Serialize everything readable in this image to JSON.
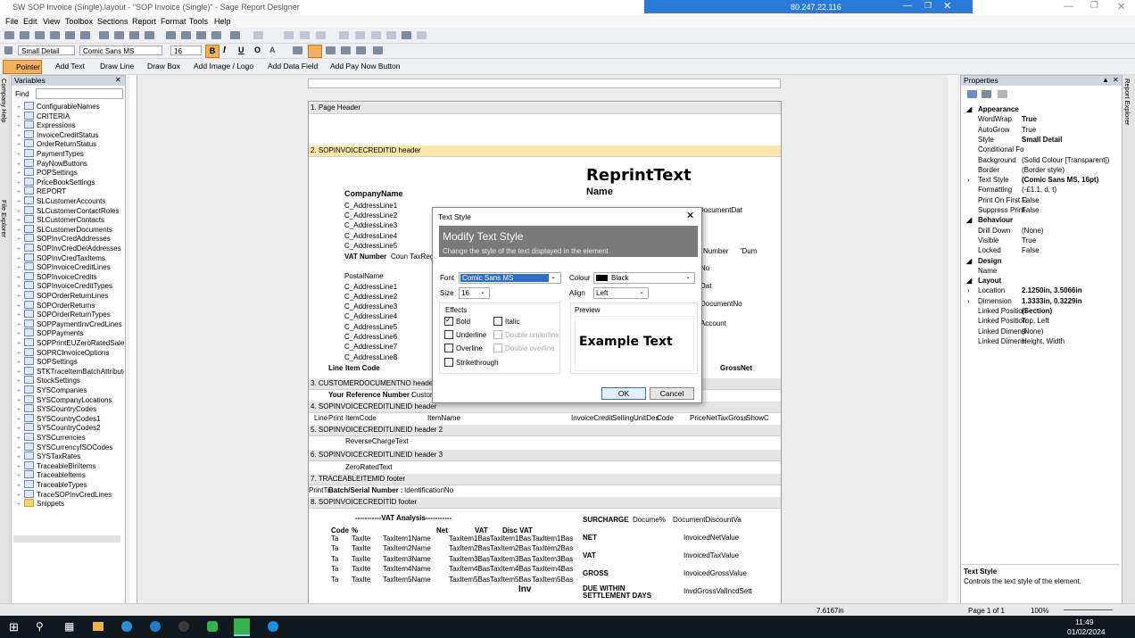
{
  "window": {
    "title": "SW SOP Invoice (Single).layout - \"SOP Invoice (Single)\" - Sage Report Designer",
    "remote_ip": "80.247.22.116"
  },
  "menu": [
    "File",
    "Edit",
    "View",
    "Toolbox",
    "Sections",
    "Report",
    "Format",
    "Tools",
    "Help"
  ],
  "format_bar": {
    "style": "Small Detail",
    "font": "Comic Sans MS",
    "size": "16"
  },
  "toolbox": {
    "pointer": "Pointer",
    "add_text": "Add Text",
    "draw_line": "Draw Line",
    "draw_box": "Draw Box",
    "add_image": "Add Image / Logo",
    "add_data_field": "Add Data Field",
    "add_pay_now": "Add Pay Now Button"
  },
  "variables_panel": {
    "title": "Variables",
    "find_label": "Find",
    "items": [
      "ConfigurableNames",
      "CRITERIA",
      "Expressions",
      "InvoiceCreditStatus",
      "OrderReturnStatus",
      "PaymentTypes",
      "PayNowButtons",
      "POPSettings",
      "PriceBookSettings",
      "REPORT",
      "SLCustomerAccounts",
      "SLCustomerContactRoles",
      "SLCustomerContacts",
      "SLCustomerDocuments",
      "SOPInvCredAddresses",
      "SOPInvCredDelAddresses",
      "SOPInvCredTaxItems",
      "SOPInvoiceCreditLines",
      "SOPInvoiceCredits",
      "SOPInvoiceCreditTypes",
      "SOPOrderReturnLines",
      "SOPOrderReturns",
      "SOPOrderReturnTypes",
      "SOPPaymentInvCredLines",
      "SOPPayments",
      "SOPPrintEUZeroRatedSalesO",
      "SOPRCInvoiceOptions",
      "SOPSettings",
      "STKTraceItemBatchAttribute",
      "StockSettings",
      "SYSCompanies",
      "SYSCompanyLocations",
      "SYSCountryCodes",
      "SYSCountryCodes1",
      "SYSCountryCodes2",
      "SYSCurrencies",
      "SYSCurrencyISOCodes",
      "SYSTaxRates",
      "TraceableBinItems",
      "TraceableItems",
      "TraceableTypes",
      "TraceSOPInvCredLines",
      "Snippets"
    ]
  },
  "side_tabs": {
    "left1": "Company Help",
    "left2": "File Explorer",
    "right": "Report Explorer"
  },
  "sections": [
    {
      "label": "1. Page Header"
    },
    {
      "label": "2. SOPINVOICECREDITID header"
    },
    {
      "label": "3. CUSTOMERDOCUMENTNO header"
    },
    {
      "label": "4. SOPINVOICECREDITLINEID header"
    },
    {
      "label": "5. SOPINVOICECREDITLINEID header 2"
    },
    {
      "label": "6. SOPINVOICECREDITLINEID header 3"
    },
    {
      "label": "7. TRACEABLEITEMID footer"
    },
    {
      "label": "8. SOPINVOICECREDITID footer"
    }
  ],
  "report_fields": {
    "reprint": "ReprintText",
    "name": "Name",
    "company": "CompanyName",
    "addr": [
      "C_AddressLine1",
      "C_AddressLine2",
      "C_AddressLine3",
      "C_AddressLine4",
      "C_AddressLine5"
    ],
    "vat_label": "VAT Number",
    "vat_value": "Coun TaxReg",
    "postal": "PostalName",
    "addr2": [
      "C_AddressLine1",
      "C_AddressLine2",
      "C_AddressLine3",
      "C_AddressLine4",
      "C_AddressLine5",
      "C_AddressLine6",
      "C_AddressLine7",
      "C_AddressLine8"
    ],
    "line": "Line",
    "item_code": "Item Code",
    "gross": "GrossNet",
    "document_dat": "DocumentDat",
    "number": "Number",
    "dum": "'Dum",
    "no": "No",
    "dat": "Dat",
    "document_no": "DocumentNo",
    "account": "Account",
    "your_ref": "Your Reference Number :",
    "custom": "Custom",
    "lineid_row": [
      "Line",
      "Print",
      "ItemCode",
      "ItemName",
      "InvoiceCredit",
      "SellingUnitDes",
      "Code",
      "PriceNetTaxGross",
      "ShowC"
    ],
    "reverse": "ReverseChargeText",
    "zero": "ZeroRatedText",
    "trace_row": [
      "PrintTr",
      "Batch/Serial Number :",
      "IdentificationNo"
    ],
    "vat_analysis": "-----------VAT Analysis-----------",
    "vat_cols": [
      "Code",
      "%",
      "Net",
      "VAT",
      "Disc VAT"
    ],
    "vat_rows": [
      [
        "Ta",
        "TaxIte",
        "TaxItem1Name",
        "TaxItem1Bas",
        "TaxItem1Bas",
        "TaxItem1Bas"
      ],
      [
        "Ta",
        "TaxIte",
        "TaxItem2Name",
        "TaxItem2Bas",
        "TaxItem2Bas",
        "TaxItem2Bas"
      ],
      [
        "Ta",
        "TaxIte",
        "TaxItem3Name",
        "TaxItem3Bas",
        "TaxItem3Bas",
        "TaxItem3Bas"
      ],
      [
        "Ta",
        "TaxIte",
        "TaxItem4Name",
        "TaxItem4Bas",
        "TaxItem4Bas",
        "TaxItem4Bas"
      ],
      [
        "Ta",
        "TaxIte",
        "TaxItem5Name",
        "TaxItem5Bas",
        "TaxItem5Bas",
        "TaxItem5Bas"
      ]
    ],
    "inv": "Inv",
    "totals": [
      [
        "SURCHARGE",
        "Docume%",
        "DocumentDiscountVa"
      ],
      [
        "NET",
        "",
        "InvoicedNetValue"
      ],
      [
        "VAT",
        "",
        "InvoicedTaxValue"
      ],
      [
        "GROSS",
        "",
        "InvoicedGrossValue"
      ],
      [
        "DUE WITHIN SETTLEMENT DAYS",
        "",
        "InvdGrossValIncdSett"
      ]
    ]
  },
  "properties": {
    "title": "Properties",
    "groups": [
      {
        "cat": "Appearance",
        "rows": [
          [
            "WordWrap",
            "True"
          ],
          [
            "AutoGrow",
            "True"
          ],
          [
            "Style",
            "Small Detail"
          ],
          [
            "Conditional Fo",
            ""
          ],
          [
            "Background",
            "(Solid Colour [Transparent])"
          ],
          [
            "Border",
            "(Border style)"
          ],
          [
            "Text Style",
            "(Comic Sans MS, 16pt)"
          ],
          [
            "Formatting",
            "(-£1.1, d, t)"
          ],
          [
            "Print On First C",
            "False"
          ],
          [
            "Suppress Print",
            "False"
          ]
        ]
      },
      {
        "cat": "Behaviour",
        "rows": [
          [
            "Drill Down",
            "(None)"
          ],
          [
            "Visible",
            "True"
          ],
          [
            "Locked",
            "False"
          ]
        ]
      },
      {
        "cat": "Design",
        "rows": [
          [
            "Name",
            ""
          ]
        ]
      },
      {
        "cat": "Layout",
        "rows": [
          [
            "Location",
            "2.1250in, 3.5066in"
          ],
          [
            "Dimension",
            "1.3333in, 0.3229in"
          ],
          [
            "Linked Position",
            "(Section)"
          ],
          [
            "Linked Position",
            "Top, Left"
          ],
          [
            "Linked Dimensi",
            "(None)"
          ],
          [
            "Linked Dimensi",
            "Height, Width"
          ]
        ]
      }
    ],
    "help_title": "Text Style",
    "help_text": "Controls the text style of the element."
  },
  "dialog": {
    "title": "Text Style",
    "heading": "Modify Text Style",
    "sub": "Change the style of the text displayed in the element",
    "font_label": "Font",
    "font_value": "Comic Sans MS",
    "size_label": "Size",
    "size_value": "16",
    "colour_label": "Colour",
    "colour_value": "Black",
    "align_label": "Align",
    "align_value": "Left",
    "effects_label": "Effects",
    "bold": "Bold",
    "italic": "Italic",
    "underline": "Underline",
    "double_underline": "Double underline",
    "overline": "Overline",
    "double_overline": "Double overline",
    "strikethrough": "Strikethrough",
    "preview_label": "Preview",
    "preview_text": "Example Text",
    "ok": "OK",
    "cancel": "Cancel"
  },
  "status": {
    "position": "7.6167in",
    "page": "Page 1 of 1",
    "zoom": "100%"
  },
  "clock": {
    "time": "11:49",
    "date": "01/02/2024"
  },
  "colors": {
    "accent": "#2f6fc9",
    "selected_section": "#fde7a8",
    "banner": "#7a7a7a"
  }
}
